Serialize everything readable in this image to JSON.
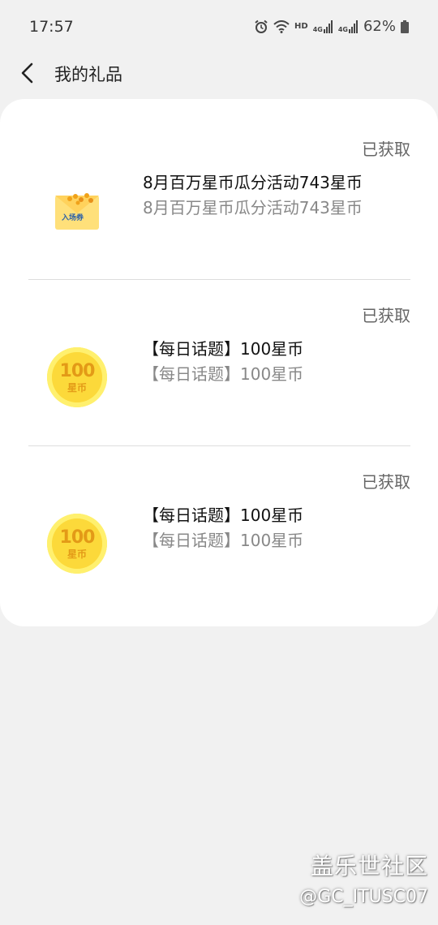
{
  "status_bar": {
    "time": "17:57",
    "network_label_1": "HD",
    "network_label_2": "4G",
    "network_label_3": "4G",
    "battery_percent": "62%",
    "icons": [
      "alarm-icon",
      "wifi-icon",
      "signal-icon",
      "signal-icon",
      "battery-icon"
    ]
  },
  "header": {
    "title": "我的礼品",
    "back_icon": "chevron-left-icon"
  },
  "gifts": [
    {
      "icon": "ticket-icon",
      "icon_label": "入场券",
      "title": "8月百万星币瓜分活动743星币",
      "subtitle": "8月百万星币瓜分活动743星币",
      "status": "已获取"
    },
    {
      "icon": "coin-icon",
      "coin_amount": "100",
      "coin_unit": "星币",
      "title": "【每日话题】100星币",
      "subtitle": "【每日话题】100星币",
      "status": "已获取"
    },
    {
      "icon": "coin-icon",
      "coin_amount": "100",
      "coin_unit": "星币",
      "title": "【每日话题】100星币",
      "subtitle": "【每日话题】100星币",
      "status": "已获取"
    }
  ],
  "watermark": {
    "text": "盖乐世社区",
    "handle": "@GC_ITUSC07"
  },
  "colors": {
    "background": "#f1f1f1",
    "card": "#ffffff",
    "coin": "#fcd93a",
    "coin_text": "#e39a17",
    "status_text": "#666666"
  }
}
